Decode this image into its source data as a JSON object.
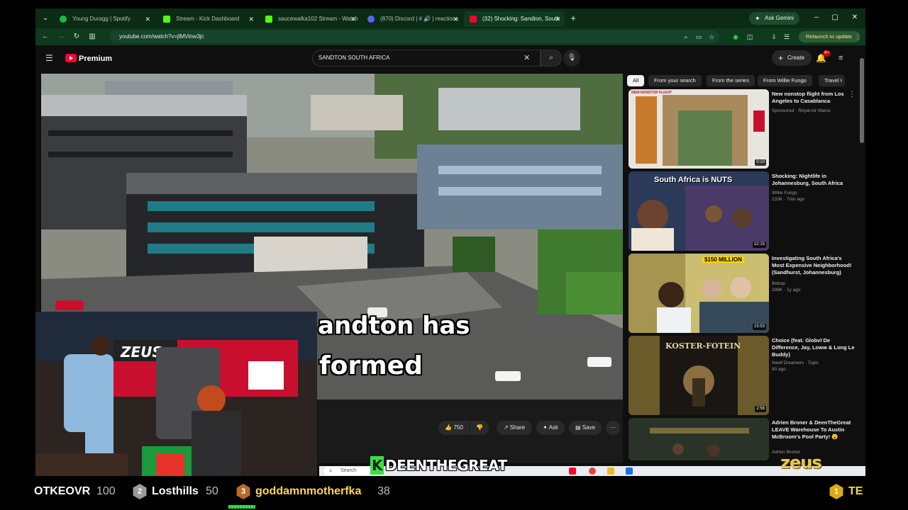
{
  "browser": {
    "tabs": [
      {
        "label": "Young Duragg | Spotify",
        "color": "#1db954"
      },
      {
        "label": "Stream - Kick Dashboard",
        "color": "#53fc18"
      },
      {
        "label": "saucewalka102 Stream - Watch",
        "color": "#53fc18"
      },
      {
        "label": "(870) Discord | # 🔊 | reactions",
        "color": "#5865f2"
      },
      {
        "label": "(32) Shocking: Sandton, South",
        "color": "#ff0033"
      }
    ],
    "ask_gemini": "Ask Gemini",
    "url": "youtube.com/watch?v=jlMVinw3jc",
    "relaunch": "Relaunch to update"
  },
  "youtube": {
    "logo_text": "Premium",
    "search_value": "SANDTON SOUTH AFRICA",
    "create_label": "Create",
    "notif_count": "9+",
    "video": {
      "caption_line1": "andton has",
      "caption_line2": "formed",
      "likes": "750",
      "actions": {
        "share": "Share",
        "ask": "Ask",
        "save": "Save"
      }
    },
    "chips": [
      "All",
      "From your search",
      "From the series",
      "From Willie Fungo",
      "Travel"
    ],
    "recommendations": [
      {
        "title": "New nonstop flight from Los Angeles to Casablanca",
        "meta1": "Sponsored · Royal Air Maroc",
        "meta2": "",
        "duration": "0:10",
        "thumb_text": "NEW NONSTOP FLIGHT"
      },
      {
        "title": "Shocking: Nightlife in Johannesburg, South Africa",
        "meta1": "Willie Fungo",
        "meta2": "133K · 7mo ago",
        "duration": "22:15",
        "thumb_text": "South Africa is NUTS"
      },
      {
        "title": "Investigating South Africa's Most Expensive Neighborhood! (Sandhurst, Johannesburg)",
        "meta1": "Bebop",
        "meta2": "299K · 1y ago",
        "duration": "15:53",
        "thumb_text": "$150 MILLION"
      },
      {
        "title": "Choice (feat. Globvl De Difference, Jay, Loww & Long Le Buddy)",
        "meta1": "Newf Dreamers · Topic",
        "meta2": "90 ago",
        "duration": "2:56",
        "thumb_text": "KOSTER-FOTEIN"
      },
      {
        "title": "Adrien Broner & DeenTheGreat LEAVE Warehouse To Austin McBroom's Pool Party! 😮",
        "meta1": "Adrien Broner",
        "meta2": "",
        "duration": "",
        "thumb_text": ""
      }
    ]
  },
  "taskbar": {
    "search_label": "Search",
    "streamer": "DEENTHEGREAT",
    "kick_letter": "K"
  },
  "brand": "zeus",
  "leaderboard": [
    {
      "rank": "",
      "name": "OTKEOVR",
      "score": "100"
    },
    {
      "rank": "2",
      "name": "Losthills",
      "score": "50"
    },
    {
      "rank": "3",
      "name": "goddamnmotherfka",
      "score": "38"
    },
    {
      "rank": "1",
      "name": "TE",
      "score": ""
    }
  ],
  "colors": {
    "accent": "#ff0033",
    "browser_green": "#0b2b14",
    "kick_green": "#3ae04a",
    "gold": "#e8c65a"
  }
}
